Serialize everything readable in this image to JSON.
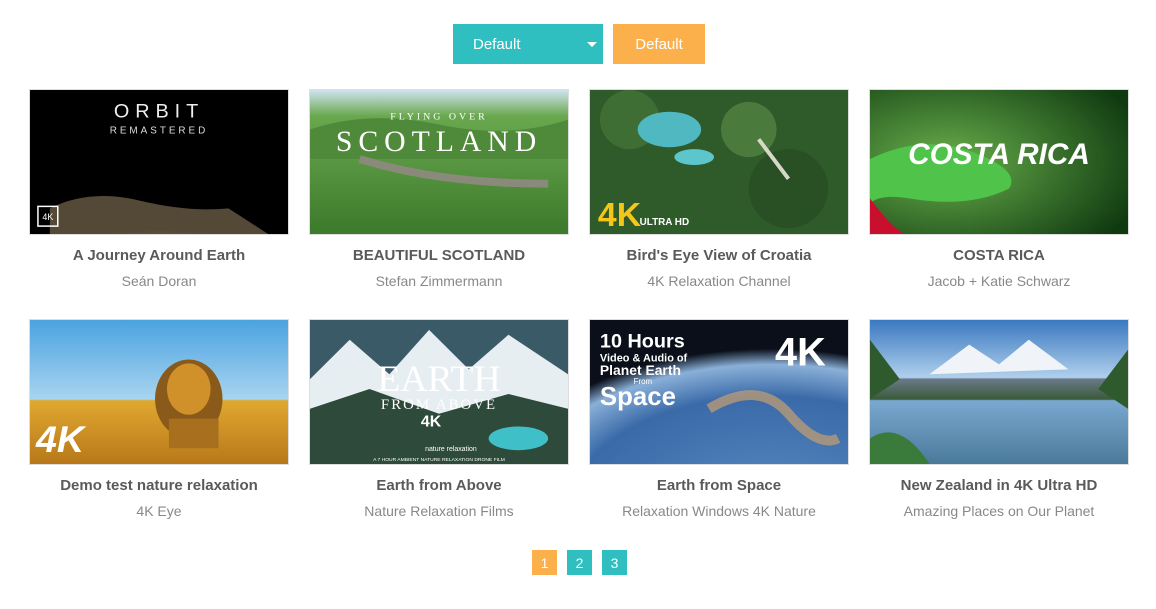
{
  "toolbar": {
    "sort_select_value": "Default",
    "sort_button_label": "Default"
  },
  "videos": [
    {
      "title": "A Journey Around Earth",
      "author": "Seán Doran",
      "thumb_text": [
        "ORBIT",
        "REMASTERED",
        "4K"
      ]
    },
    {
      "title": "BEAUTIFUL SCOTLAND",
      "author": "Stefan Zimmermann",
      "thumb_text": [
        "FLYING OVER",
        "SCOTLAND"
      ]
    },
    {
      "title": "Bird's Eye View of Croatia",
      "author": "4K Relaxation Channel",
      "thumb_text": [
        "4K",
        "ULTRA HD"
      ]
    },
    {
      "title": "COSTA RICA",
      "author": "Jacob + Katie Schwarz",
      "thumb_text": [
        "COSTA RICA"
      ]
    },
    {
      "title": "Demo test nature relaxation",
      "author": "4K Eye",
      "thumb_text": [
        "4K"
      ]
    },
    {
      "title": "Earth from Above",
      "author": "Nature Relaxation Films",
      "thumb_text": [
        "EARTH",
        "FROM ABOVE",
        "4K",
        "nature relaxation",
        "A 7 HOUR AMBIENT NATURE RELAXATION DRONE FILM"
      ]
    },
    {
      "title": "Earth from Space",
      "author": "Relaxation Windows 4K Nature",
      "thumb_text": [
        "10 Hours",
        "Video & Audio of",
        "Planet Earth",
        "From",
        "Space",
        "4K"
      ]
    },
    {
      "title": "New Zealand in 4K Ultra HD",
      "author": "Amazing Places on Our Planet",
      "thumb_text": []
    }
  ],
  "pagination": {
    "pages": [
      "1",
      "2",
      "3"
    ],
    "current": "1"
  },
  "colors": {
    "accent_teal": "#2fbfc0",
    "accent_orange": "#fbb04b"
  }
}
